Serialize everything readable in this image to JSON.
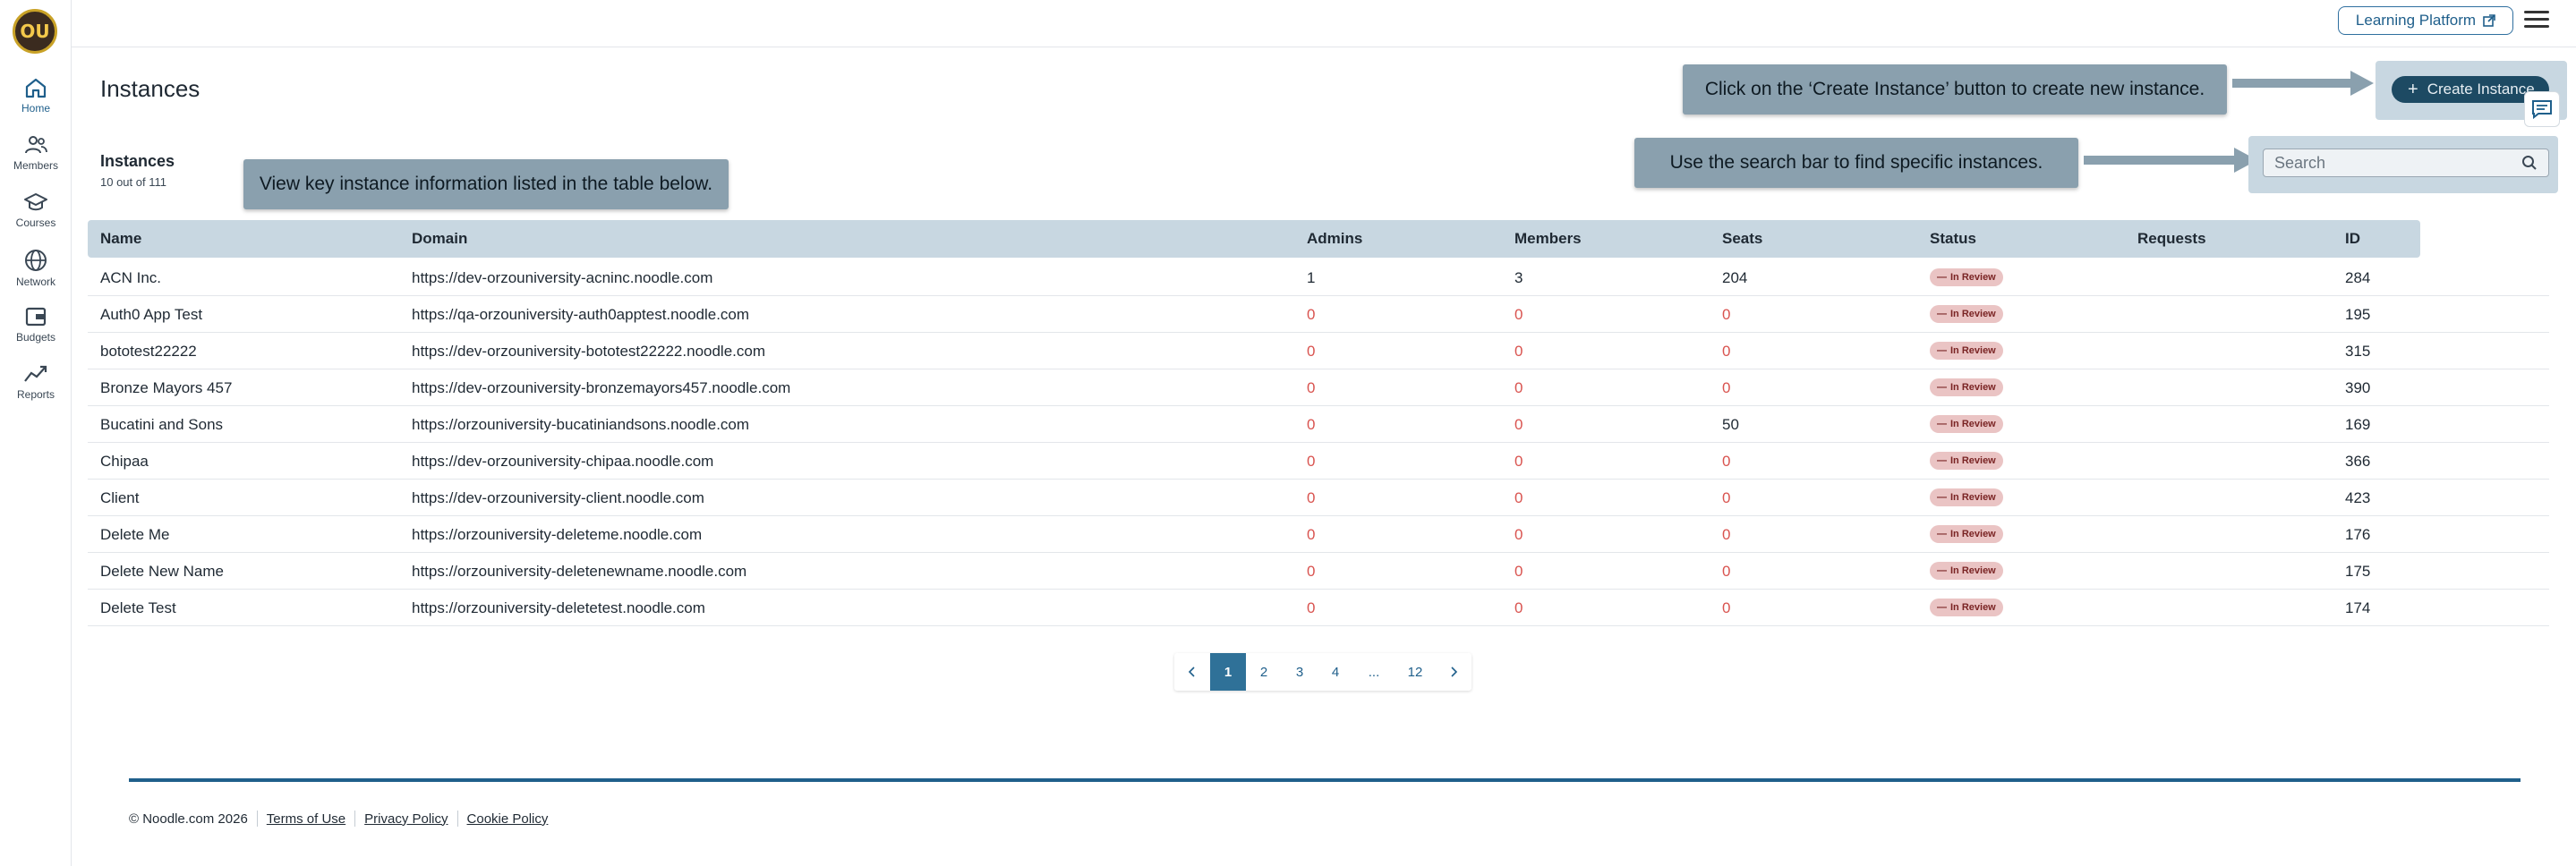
{
  "sidebar": {
    "logo_text": "OU",
    "items": [
      {
        "label": "Home",
        "icon": "home-icon"
      },
      {
        "label": "Members",
        "icon": "members-icon"
      },
      {
        "label": "Courses",
        "icon": "courses-icon"
      },
      {
        "label": "Network",
        "icon": "globe-icon"
      },
      {
        "label": "Budgets",
        "icon": "wallet-icon"
      },
      {
        "label": "Reports",
        "icon": "chart-icon"
      }
    ]
  },
  "topbar": {
    "learning_platform_label": "Learning Platform"
  },
  "page": {
    "title": "Instances",
    "create_button_label": "Create Instance",
    "search_placeholder": "Search",
    "section_title": "Instances",
    "section_count": "10 out of 111"
  },
  "callouts": {
    "create": "Click on the ‘Create Instance’ button to create new instance.",
    "search": "Use the search bar to find specific instances.",
    "table": "View key instance information listed in the table below."
  },
  "table": {
    "columns": [
      "Name",
      "Domain",
      "Admins",
      "Members",
      "Seats",
      "Status",
      "Requests",
      "ID"
    ],
    "rows": [
      {
        "name": "ACN Inc.",
        "domain": "https://dev-orzouniversity-acninc.noodle.com",
        "admins": "1",
        "members": "3",
        "seats": "204",
        "status": "In Review",
        "requests": "",
        "id": "284"
      },
      {
        "name": "Auth0 App Test",
        "domain": "https://qa-orzouniversity-auth0apptest.noodle.com",
        "admins": "0",
        "members": "0",
        "seats": "0",
        "status": "In Review",
        "requests": "",
        "id": "195"
      },
      {
        "name": "bototest22222",
        "domain": "https://dev-orzouniversity-bototest22222.noodle.com",
        "admins": "0",
        "members": "0",
        "seats": "0",
        "status": "In Review",
        "requests": "",
        "id": "315"
      },
      {
        "name": "Bronze Mayors 457",
        "domain": "https://dev-orzouniversity-bronzemayors457.noodle.com",
        "admins": "0",
        "members": "0",
        "seats": "0",
        "status": "In Review",
        "requests": "",
        "id": "390"
      },
      {
        "name": "Bucatini and Sons",
        "domain": "https://orzouniversity-bucatiniandsons.noodle.com",
        "admins": "0",
        "members": "0",
        "seats": "50",
        "status": "In Review",
        "requests": "",
        "id": "169"
      },
      {
        "name": "Chipaa",
        "domain": "https://dev-orzouniversity-chipaa.noodle.com",
        "admins": "0",
        "members": "0",
        "seats": "0",
        "status": "In Review",
        "requests": "",
        "id": "366"
      },
      {
        "name": "Client",
        "domain": "https://dev-orzouniversity-client.noodle.com",
        "admins": "0",
        "members": "0",
        "seats": "0",
        "status": "In Review",
        "requests": "",
        "id": "423"
      },
      {
        "name": "Delete Me",
        "domain": "https://orzouniversity-deleteme.noodle.com",
        "admins": "0",
        "members": "0",
        "seats": "0",
        "status": "In Review",
        "requests": "",
        "id": "176"
      },
      {
        "name": "Delete New Name",
        "domain": "https://orzouniversity-deletenewname.noodle.com",
        "admins": "0",
        "members": "0",
        "seats": "0",
        "status": "In Review",
        "requests": "",
        "id": "175"
      },
      {
        "name": "Delete Test",
        "domain": "https://orzouniversity-deletetest.noodle.com",
        "admins": "0",
        "members": "0",
        "seats": "0",
        "status": "In Review",
        "requests": "",
        "id": "174"
      }
    ]
  },
  "pagination": {
    "pages": [
      "1",
      "2",
      "3",
      "4",
      "...",
      "12"
    ],
    "current": "1"
  },
  "footer": {
    "copyright": "© Noodle.com 2026",
    "links": [
      "Terms of Use",
      "Privacy Policy",
      "Cookie Policy"
    ]
  },
  "colors": {
    "accent": "#1f5f8b",
    "header_bg": "#c8d7e1",
    "callout_bg": "#8aa0ae",
    "zero_value": "#d9534f",
    "badge_bg": "#eac4c4"
  }
}
